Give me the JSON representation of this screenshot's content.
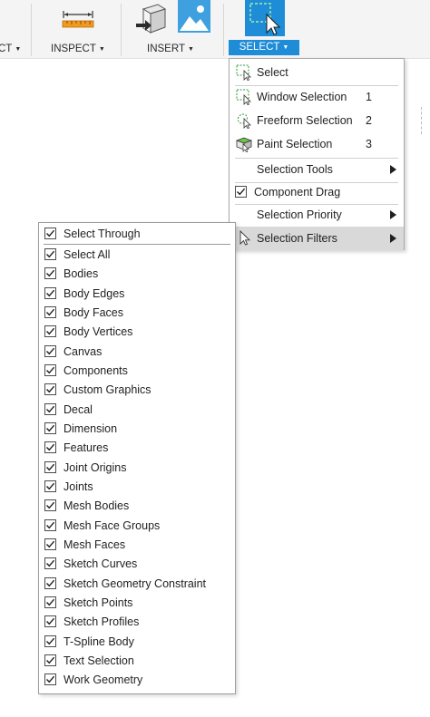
{
  "toolbar": {
    "partial_label": "CT",
    "inspect_label": "INSPECT",
    "insert_label": "INSERT",
    "select_label": "SELECT"
  },
  "icons": {
    "inspect": "measure-ruler-icon",
    "insert_a": "insert-derive-icon",
    "insert_b": "insert-image-icon",
    "select": "select-arrow-icon"
  },
  "colors": {
    "accent": "#1e8cd6",
    "highlight": "#d9d9d9",
    "measure_orange": "#f39a1e"
  },
  "select_menu": {
    "items": [
      {
        "label": "Select",
        "key": ""
      },
      {
        "label": "Window Selection",
        "key": "1"
      },
      {
        "label": "Freeform Selection",
        "key": "2"
      },
      {
        "label": "Paint Selection",
        "key": "3"
      },
      {
        "label": "Selection Tools",
        "key": ""
      },
      {
        "label": "Component Drag",
        "key": ""
      },
      {
        "label": "Selection Priority",
        "key": ""
      },
      {
        "label": "Selection Filters",
        "key": ""
      }
    ]
  },
  "filters_menu": {
    "select_through": "Select Through",
    "items": [
      "Select All",
      "Bodies",
      "Body Edges",
      "Body Faces",
      "Body Vertices",
      "Canvas",
      "Components",
      "Custom Graphics",
      "Decal",
      "Dimension",
      "Features",
      "Joint Origins",
      "Joints",
      "Mesh Bodies",
      "Mesh Face Groups",
      "Mesh Faces",
      "Sketch Curves",
      "Sketch Geometry Constraint",
      "Sketch Points",
      "Sketch Profiles",
      "T-Spline Body",
      "Text Selection",
      "Work Geometry"
    ]
  }
}
